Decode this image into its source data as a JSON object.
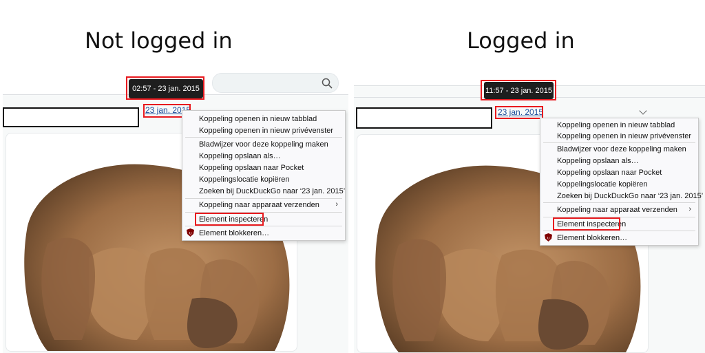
{
  "headings": {
    "left": "Not logged in",
    "right": "Logged in"
  },
  "panes": [
    {
      "tooltip": "02:57 - 23 jan. 2015",
      "date_link": "23 jan. 2015",
      "menu": {
        "items": [
          "Koppeling openen in nieuw tabblad",
          "Koppeling openen in nieuw privévenster",
          "Bladwijzer voor deze koppeling maken",
          "Koppeling opslaan als…",
          "Koppeling opslaan naar Pocket",
          "Koppelingslocatie kopiëren",
          "Zoeken bij DuckDuckGo naar ‘23 jan. 2015’",
          "Koppeling naar apparaat verzenden",
          "Element inspecteren",
          "Element blokkeren…"
        ]
      }
    },
    {
      "tooltip": "11:57 - 23 jan. 2015",
      "date_link": "23 jan. 2015",
      "menu": {
        "items": [
          "Koppeling openen in nieuw tabblad",
          "Koppeling openen in nieuw privévenster",
          "Bladwijzer voor deze koppeling maken",
          "Koppeling opslaan als…",
          "Koppeling opslaan naar Pocket",
          "Koppelingslocatie kopiëren",
          "Zoeken bij DuckDuckGo naar ‘23 jan. 2015’",
          "Koppeling naar apparaat verzenden",
          "Element inspecteren",
          "Element blokkeren…"
        ]
      }
    }
  ],
  "icons": {
    "search": "search-icon",
    "chevron": "chevron-down-icon",
    "submenu": "chevron-right-icon",
    "ublock": "ublock-shield-icon"
  },
  "colors": {
    "highlight": "#e8191e",
    "link": "#1d4e9b",
    "tooltip_bg": "#1e1e1e"
  }
}
